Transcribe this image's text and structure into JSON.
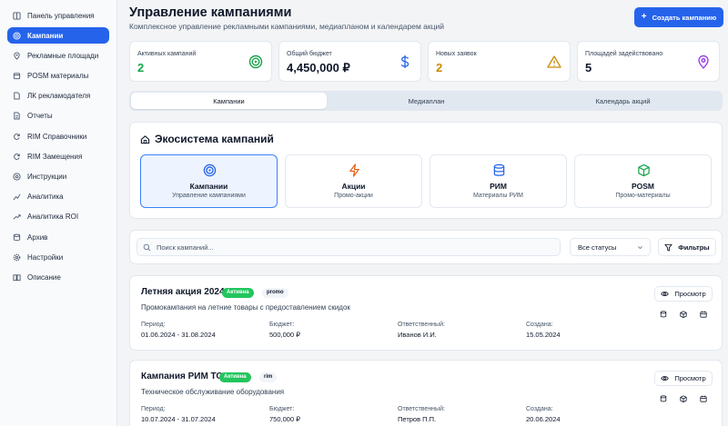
{
  "sidebar": {
    "items": [
      {
        "label": "Панель управления",
        "icon": "dashboard-icon"
      },
      {
        "label": "Кампании",
        "icon": "target-icon",
        "active": true
      },
      {
        "label": "Рекламные площади",
        "icon": "map-pin-icon"
      },
      {
        "label": "POSM материалы",
        "icon": "box-icon"
      },
      {
        "label": "ЛК рекламодателя",
        "icon": "file-icon"
      },
      {
        "label": "Отчеты",
        "icon": "report-icon"
      },
      {
        "label": "RIM Справочники",
        "icon": "refresh-icon"
      },
      {
        "label": "RIM Замещения",
        "icon": "refresh-icon"
      },
      {
        "label": "Инструкции",
        "icon": "help-icon"
      },
      {
        "label": "Аналитика",
        "icon": "chart-icon"
      },
      {
        "label": "Аналитика ROI",
        "icon": "trend-icon"
      },
      {
        "label": "Архив",
        "icon": "database-icon"
      },
      {
        "label": "Настройки",
        "icon": "gear-icon"
      },
      {
        "label": "Описание",
        "icon": "book-icon"
      }
    ]
  },
  "header": {
    "title": "Управление кампаниями",
    "subtitle": "Комплексное управление рекламными кампаниями, медиапланом и календарем акций",
    "create_button": "Создать кампанию"
  },
  "stats": [
    {
      "label": "Активных кампаний",
      "value": "2",
      "color": "#16a34a",
      "icon": "target-icon"
    },
    {
      "label": "Общий бюджет",
      "value": "4,450,000 ₽",
      "color": "#2563eb",
      "icon": "dollar-icon"
    },
    {
      "label": "Новых заявок",
      "value": "2",
      "color": "#ca8a04",
      "icon": "warning-icon"
    },
    {
      "label": "Площадей задействовано",
      "value": "5",
      "color": "#9333ea",
      "icon": "map-pin-icon"
    }
  ],
  "tabs": [
    "Кампании",
    "Медиаплан",
    "Календарь акций"
  ],
  "ecosystem": {
    "title": "Экосистема кампаний",
    "cards": [
      {
        "title": "Кампании",
        "subtitle": "Управление кампаниями",
        "icon": "target-icon",
        "color": "#2563eb"
      },
      {
        "title": "Акции",
        "subtitle": "Промо-акции",
        "icon": "lightning-icon",
        "color": "#ea580c"
      },
      {
        "title": "РИМ",
        "subtitle": "Материалы РИМ",
        "icon": "database-icon",
        "color": "#2563eb"
      },
      {
        "title": "POSM",
        "subtitle": "Промо-материалы",
        "icon": "box-icon",
        "color": "#16a34a"
      }
    ]
  },
  "filters": {
    "search_placeholder": "Поиск кампаний...",
    "status_value": "Все статусы",
    "filters_button": "Фильтры"
  },
  "campaigns": [
    {
      "name": "Летняя акция 2024",
      "status": "Активна",
      "tag": "promo",
      "description": "Промокампания на летние товары с предоставлением скидок",
      "period_label": "Период:",
      "period": "01.06.2024 - 31.08.2024",
      "budget_label": "Бюджет:",
      "budget": "500,000 ₽",
      "owner_label": "Ответственный:",
      "owner": "Иванов И.И.",
      "created_label": "Создана:",
      "created": "15.05.2024",
      "view_button": "Просмотр"
    },
    {
      "name": "Кампания РИМ ТО",
      "status": "Активна",
      "tag": "rim",
      "description": "Техническое обслуживание оборудования",
      "period_label": "Период:",
      "period": "10.07.2024 - 31.07.2024",
      "budget_label": "Бюджет:",
      "budget": "750,000 ₽",
      "owner_label": "Ответственный:",
      "owner": "Петров П.П.",
      "created_label": "Создана:",
      "created": "20.06.2024",
      "view_button": "Просмотр"
    }
  ]
}
